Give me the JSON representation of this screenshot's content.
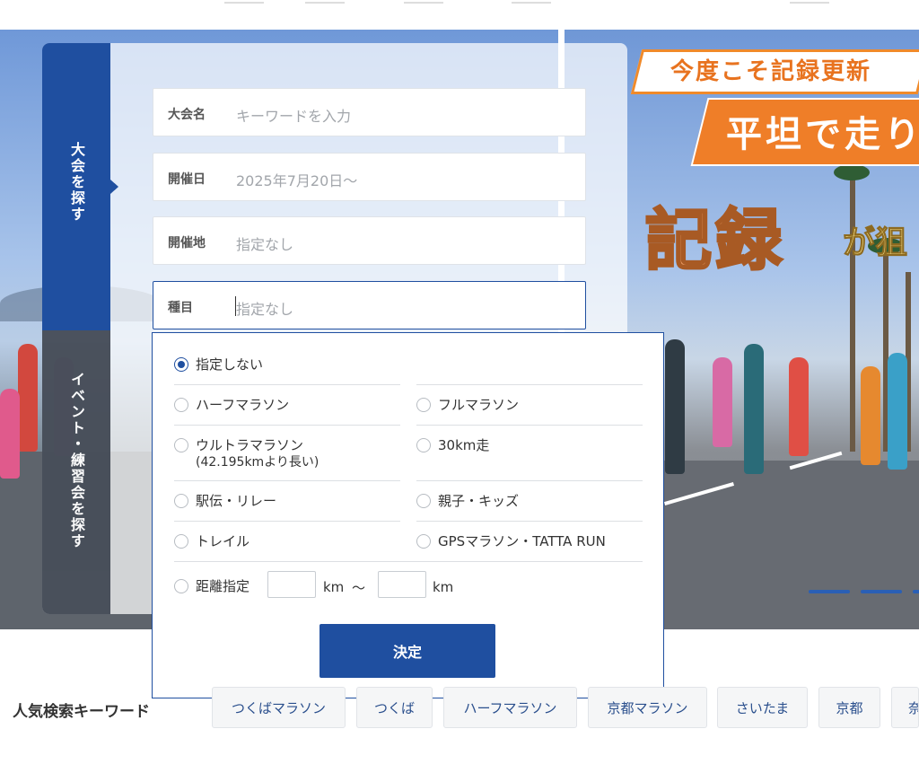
{
  "search": {
    "tab_primary": "大会を探す",
    "tab_secondary": "イベント・練習会を探す",
    "fields": [
      {
        "label": "大会名",
        "placeholder": "キーワードを入力"
      },
      {
        "label": "開催日",
        "value": "2025年7月20日〜"
      },
      {
        "label": "開催地",
        "value": "指定なし"
      },
      {
        "label": "種目",
        "value": "指定なし"
      }
    ],
    "options": {
      "none": "指定しない",
      "half": "ハーフマラソン",
      "full": "フルマラソン",
      "ultra": "ウルトラマラソン",
      "ultra_note": "(42.195kmより長い)",
      "km30": "30km走",
      "ekiden": "駅伝・リレー",
      "kids": "親子・キッズ",
      "trail": "トレイル",
      "gps": "GPSマラソン・TATTA RUN",
      "distance": "距離指定",
      "km_unit_from": "km",
      "range_sep": "〜",
      "km_unit_to": "km",
      "selected": "指定しない"
    },
    "decide_label": "決定"
  },
  "banner": {
    "line1": "今度こそ記録更新",
    "line2": "平坦で走り",
    "line3_big": "記録",
    "line3_small": "が狙"
  },
  "keywords": {
    "title": "人気検索キーワード",
    "items": [
      "つくばマラソン",
      "つくば",
      "ハーフマラソン",
      "京都マラソン",
      "さいたま",
      "京都",
      "奈"
    ]
  },
  "colors": {
    "brand": "#1f4fa0",
    "accent_orange": "#ef7e28"
  }
}
